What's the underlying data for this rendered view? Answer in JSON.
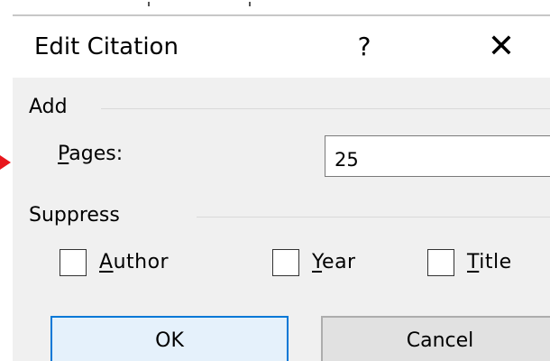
{
  "dialog": {
    "title": "Edit Citation",
    "help_glyph": "?",
    "close_glyph": "✕"
  },
  "add_group": {
    "title": "Add",
    "pages_label_accel": "P",
    "pages_label_rest": "ages:",
    "pages_value": "25"
  },
  "suppress_group": {
    "title": "Suppress",
    "options": [
      {
        "accel": "A",
        "rest": "uthor",
        "checked": false
      },
      {
        "accel": "Y",
        "rest": "ear",
        "checked": false
      },
      {
        "accel": "T",
        "rest": "itle",
        "checked": false
      }
    ]
  },
  "buttons": {
    "ok": "OK",
    "cancel": "Cancel"
  },
  "colors": {
    "dialog_bg": "#f0f0f0",
    "accent_border": "#0078d7",
    "ok_bg": "#e5f1fb",
    "pointer_arrow": "#e8161c"
  },
  "icons": {
    "help": "help-icon",
    "close": "close-icon",
    "pointer": "red-arrow-pointer-icon"
  }
}
